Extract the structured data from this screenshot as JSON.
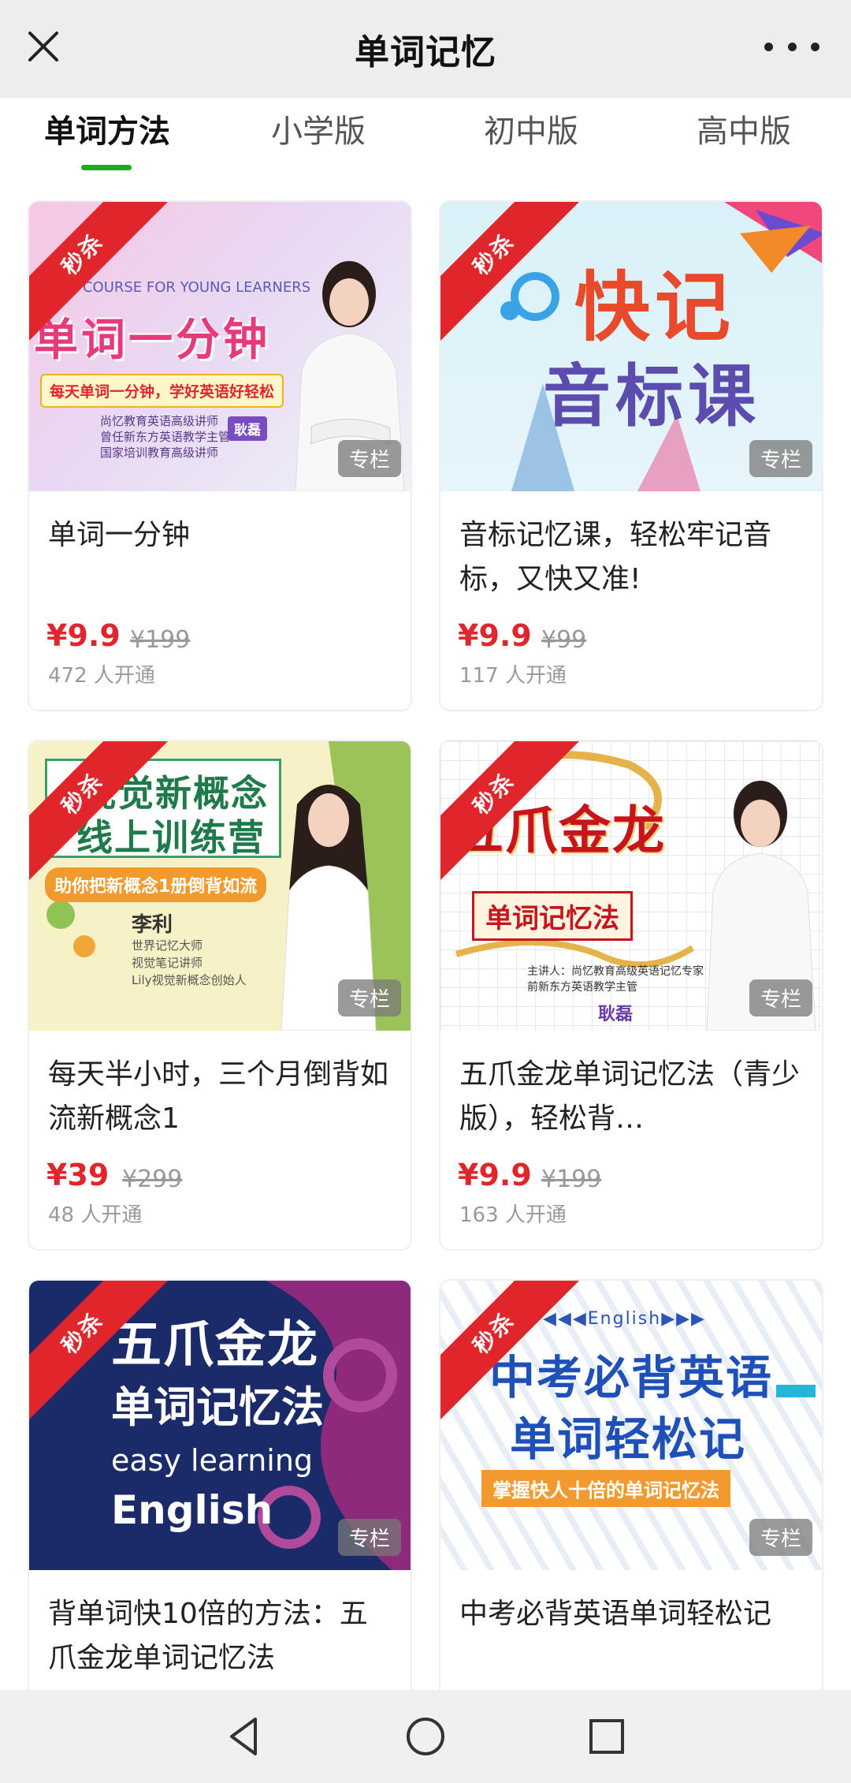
{
  "header": {
    "title": "单词记忆",
    "close_icon": "close-icon",
    "more_icon": "more-icon"
  },
  "tabs": [
    {
      "label": "单词方法",
      "active": true
    },
    {
      "label": "小学版",
      "active": false
    },
    {
      "label": "初中版",
      "active": false
    },
    {
      "label": "高中版",
      "active": false
    }
  ],
  "colors": {
    "accent_green": "#1aad19",
    "price_red": "#e0262b",
    "ribbon_red": "#e0262b"
  },
  "products": [
    {
      "ribbon": "秒杀",
      "badge": "专栏",
      "title": "单词一分钟",
      "price": "¥9.9",
      "original_price": "¥199",
      "sold": "472 人开通",
      "thumb": {
        "top_line": "GLISH COURSE FOR YOUNG LEARNERS",
        "headline": "单词一分钟",
        "tagline": "每天单词一分钟，学好英语好轻松",
        "info_lines": [
          "尚忆教育英语高级讲师",
          "曾任新东方英语教学主管",
          "国家培训教育高级讲师"
        ],
        "name_tag": "耿磊"
      }
    },
    {
      "ribbon": "秒杀",
      "badge": "专栏",
      "title": "音标记忆课，轻松牢记音标，又快又准!",
      "price": "¥9.9",
      "original_price": "¥99",
      "sold": "117 人开通",
      "thumb": {
        "headline_1": "快记",
        "headline_2": "音标课"
      }
    },
    {
      "ribbon": "秒杀",
      "badge": "专栏",
      "title": "每天半小时，三个月倒背如流新概念1",
      "price": "¥39",
      "original_price": "¥299",
      "sold": "48 人开通",
      "thumb": {
        "headline_1": "视觉新概念",
        "headline_2": "线上训练营",
        "tagline": "助你把新概念1册倒背如流",
        "name": "李利",
        "info_lines": [
          "世界记忆大师",
          "视觉笔记讲师",
          "Lily视觉新概念创始人"
        ]
      }
    },
    {
      "ribbon": "秒杀",
      "badge": "专栏",
      "title": "五爪金龙单词记忆法（青少版），轻松背…",
      "price": "¥9.9",
      "original_price": "¥199",
      "sold": "163 人开通",
      "thumb": {
        "headline": "五爪金龙",
        "subhead": "单词记忆法",
        "info_lines": [
          "主讲人：尚忆教育高级英语记忆专家",
          "前新东方英语教学主管"
        ],
        "name_tag": "耿磊"
      }
    },
    {
      "ribbon": "秒杀",
      "badge": "专栏",
      "title": "背单词快10倍的方法：五爪金龙单词记忆法",
      "price": "",
      "original_price": "",
      "sold": "",
      "thumb": {
        "headline_1": "五爪金龙",
        "headline_2": "单词记忆法",
        "en_1": "easy learning",
        "en_2": "English"
      }
    },
    {
      "ribbon": "秒杀",
      "badge": "专栏",
      "title": "中考必背英语单词轻松记",
      "price": "",
      "original_price": "",
      "sold": "",
      "thumb": {
        "top_tag": "English",
        "headline_1": "中考必背英语",
        "headline_2": "单词轻松记",
        "tagline": "掌握快人十倍的单词记忆法"
      }
    }
  ],
  "navbar": {
    "back_icon": "back-icon",
    "home_icon": "home-icon",
    "recents_icon": "recents-icon"
  }
}
